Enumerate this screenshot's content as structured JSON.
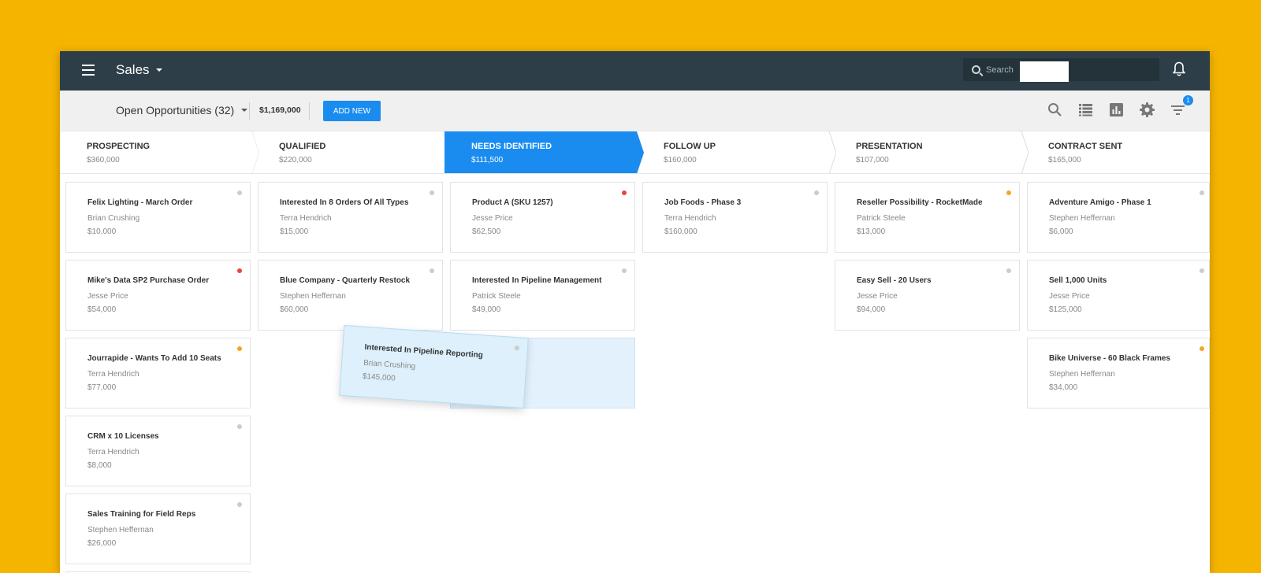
{
  "header": {
    "app_title": "Sales",
    "search_placeholder": "Search"
  },
  "toolbar": {
    "view_label": "Open Opportunities (32)",
    "total": "$1,169,000",
    "add_label": "ADD NEW",
    "filter_badge": "1"
  },
  "stages": [
    {
      "name": "PROSPECTING",
      "total": "$360,000"
    },
    {
      "name": "QUALIFIED",
      "total": "$220,000"
    },
    {
      "name": "NEEDS IDENTIFIED",
      "total": "$111,500"
    },
    {
      "name": "FOLLOW UP",
      "total": "$160,000"
    },
    {
      "name": "PRESENTATION",
      "total": "$107,000"
    },
    {
      "name": "CONTRACT SENT",
      "total": "$165,000"
    }
  ],
  "columns": [
    {
      "cards": [
        {
          "title": "Felix Lighting - March Order",
          "owner": "Brian Crushing",
          "amount": "$10,000"
        },
        {
          "title": "Mike's Data SP2 Purchase Order",
          "owner": "Jesse Price",
          "amount": "$54,000"
        },
        {
          "title": "Jourrapide - Wants To Add 10 Seats",
          "owner": "Terra Hendrich",
          "amount": "$77,000"
        },
        {
          "title": "CRM x 10 Licenses",
          "owner": "Terra Hendrich",
          "amount": "$8,000"
        },
        {
          "title": "Sales Training for Field Reps",
          "owner": "Stephen Heffernan",
          "amount": "$26,000"
        }
      ]
    },
    {
      "cards": [
        {
          "title": "Interested In 8 Orders Of All Types",
          "owner": "Terra Hendrich",
          "amount": "$15,000"
        },
        {
          "title": "Blue Company - Quarterly Restock",
          "owner": "Stephen Heffernan",
          "amount": "$60,000"
        }
      ]
    },
    {
      "cards": [
        {
          "title": "Product A (SKU 1257)",
          "owner": "Jesse Price",
          "amount": "$62,500"
        },
        {
          "title": "Interested In Pipeline Management",
          "owner": "Patrick Steele",
          "amount": "$49,000"
        }
      ]
    },
    {
      "cards": [
        {
          "title": "Job Foods - Phase 3",
          "owner": "Terra Hendrich",
          "amount": "$160,000"
        }
      ]
    },
    {
      "cards": [
        {
          "title": "Reseller Possibility - RocketMade",
          "owner": "Patrick Steele",
          "amount": "$13,000"
        },
        {
          "title": "Easy Sell - 20 Users",
          "owner": "Jesse Price",
          "amount": "$94,000"
        }
      ]
    },
    {
      "cards": [
        {
          "title": "Adventure Amigo - Phase 1",
          "owner": "Stephen Heffernan",
          "amount": "$6,000"
        },
        {
          "title": "Sell 1,000 Units",
          "owner": "Jesse Price",
          "amount": "$125,000"
        },
        {
          "title": "Bike Universe - 60 Black Frames",
          "owner": "Stephen Heffernan",
          "amount": "$34,000"
        }
      ]
    }
  ],
  "dragging_card": {
    "title": "Interested In Pipeline Reporting",
    "owner": "Brian Crushing",
    "amount": "$145,000"
  },
  "colors": {
    "header_bg": "#2D3E48",
    "accent": "#1A8CF0",
    "dot_gray": "#CCCCCC",
    "dot_red": "#E8453C",
    "dot_orange": "#F5A623"
  }
}
